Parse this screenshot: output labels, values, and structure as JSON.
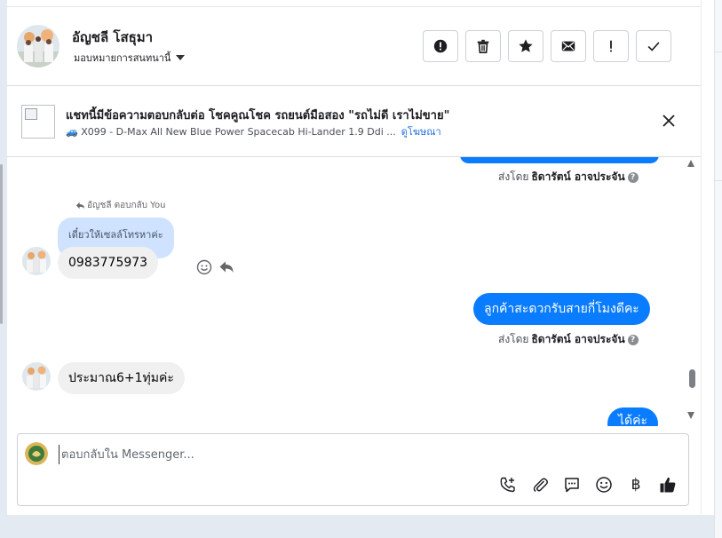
{
  "header": {
    "contact_name": "อัญชลี โสธุมา",
    "assign_label": "มอบหมายการสนทนานี้",
    "actions": [
      {
        "name": "spam",
        "label": "!"
      },
      {
        "name": "delete",
        "label": "trash"
      },
      {
        "name": "star",
        "label": "star"
      },
      {
        "name": "mail",
        "label": "mail"
      },
      {
        "name": "important",
        "label": "!"
      },
      {
        "name": "done",
        "label": "check"
      }
    ]
  },
  "ad": {
    "title": "แชทนี้มีข้อความตอบกลับต่อ โชคคูณโชค รถยนต์มือสอง \"รถไม่ดี เราไม่ขาย\"",
    "subtitle": "🚙 X099 - D-Max All New Blue Power Spacecab Hi-Lander 1.9 Ddi ...",
    "link": "ดูโฆษณา"
  },
  "messages": {
    "sent_by_prefix": "ส่งโดย",
    "sender_name": "ธิดารัตน์ อาจประจัน",
    "help_glyph": "?",
    "reply_note": "อัญชลี ตอบกลับ You",
    "quoted_text": "เดี๋ยวให้เซลล์โทรหาค่ะ",
    "phone_message": "0983775973",
    "outgoing_question": "ลูกค้าสะดวกรับสายกี่โมงดีคะ",
    "incoming_time": "ประมาณ6+1ทุ่มค่ะ",
    "partial_out": "ได้ค่ะ"
  },
  "composer": {
    "placeholder": "ตอบกลับใน Messenger...",
    "baht_glyph": "฿"
  },
  "colors": {
    "outgoing_bubble": "#0a7cff",
    "incoming_bubble": "#f0f0f0",
    "quoted_bubble": "#cfe2ff",
    "link": "#216fdb"
  }
}
